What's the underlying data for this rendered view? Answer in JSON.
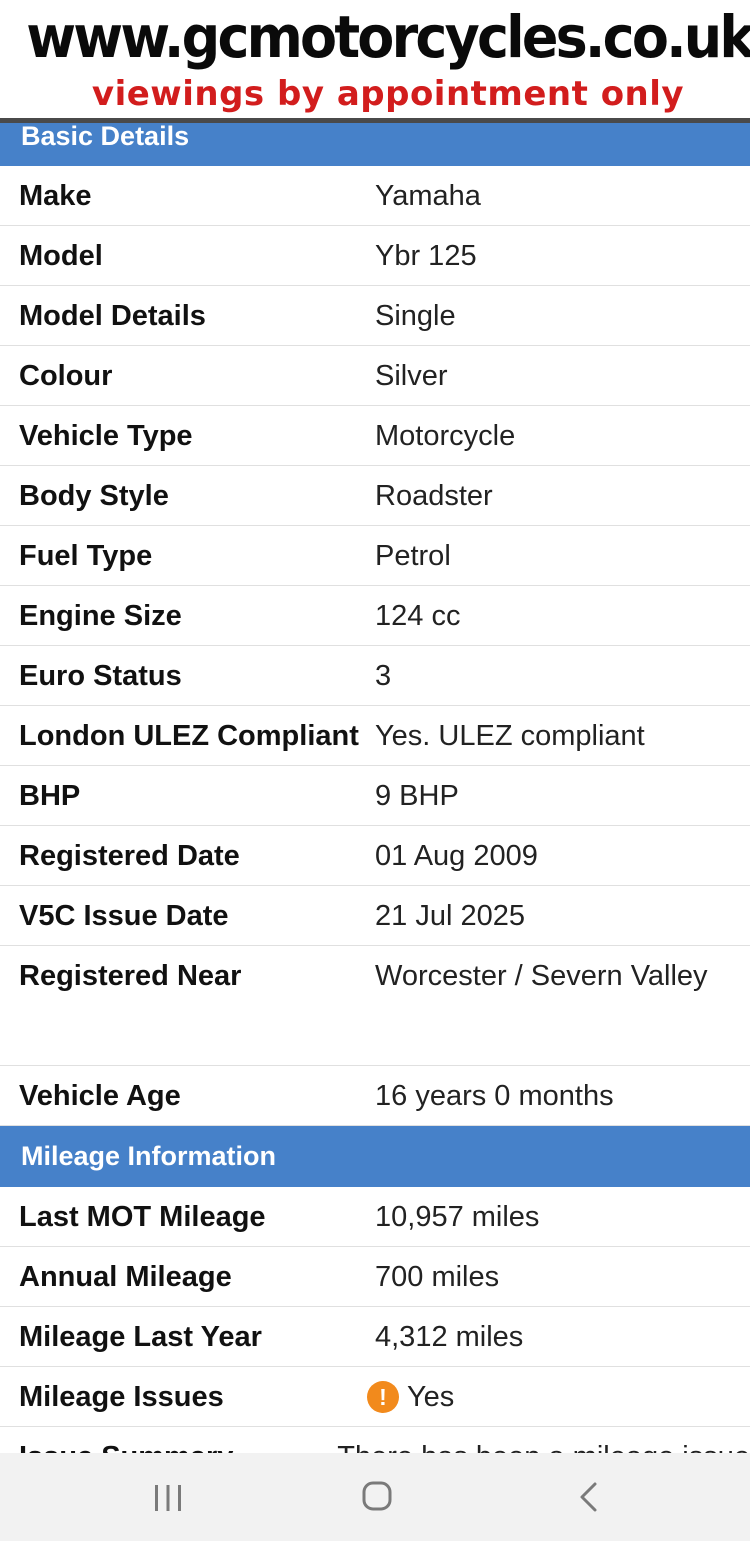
{
  "banner": {
    "url": "www.gcmotorcycles.co.uk",
    "tagline": "viewings by appointment only"
  },
  "basic_details": {
    "heading": "Basic Details",
    "rows": [
      {
        "label": "Make",
        "value": "Yamaha"
      },
      {
        "label": "Model",
        "value": "Ybr 125"
      },
      {
        "label": "Model Details",
        "value": "Single"
      },
      {
        "label": "Colour",
        "value": "Silver"
      },
      {
        "label": "Vehicle Type",
        "value": "Motorcycle"
      },
      {
        "label": "Body Style",
        "value": "Roadster"
      },
      {
        "label": "Fuel Type",
        "value": "Petrol"
      },
      {
        "label": "Engine Size",
        "value": "124 cc"
      },
      {
        "label": "Euro Status",
        "value": "3"
      },
      {
        "label": "London ULEZ Compliant",
        "value": "Yes. ULEZ compliant"
      },
      {
        "label": "BHP",
        "value": "9 BHP"
      },
      {
        "label": "Registered Date",
        "value": "01 Aug 2009"
      },
      {
        "label": "V5C Issue Date",
        "value": "21 Jul 2025"
      },
      {
        "label": "Registered Near",
        "value": "Worcester / Severn Valley"
      },
      {
        "label": "Vehicle Age",
        "value": "16 years 0 months"
      }
    ]
  },
  "mileage_information": {
    "heading": "Mileage Information",
    "rows": [
      {
        "label": "Last MOT Mileage",
        "value": "10,957 miles"
      },
      {
        "label": "Annual Mileage",
        "value": "700 miles"
      },
      {
        "label": "Mileage Last Year",
        "value": "4,312 miles"
      },
      {
        "label": "Mileage Issues",
        "value": "Yes",
        "icon": "warning-icon",
        "icon_glyph": "!",
        "icon_color": "#f28a1c"
      },
      {
        "label": "Issue Summary",
        "value": "There has been a mileage issue"
      }
    ]
  },
  "colors": {
    "section_header": "#4681c9",
    "banner_tagline": "#d21d1d",
    "warning": "#f28a1c"
  },
  "system_nav": {
    "recent_icon": "recent-apps-icon",
    "home_icon": "home-icon",
    "back_icon": "back-icon"
  }
}
